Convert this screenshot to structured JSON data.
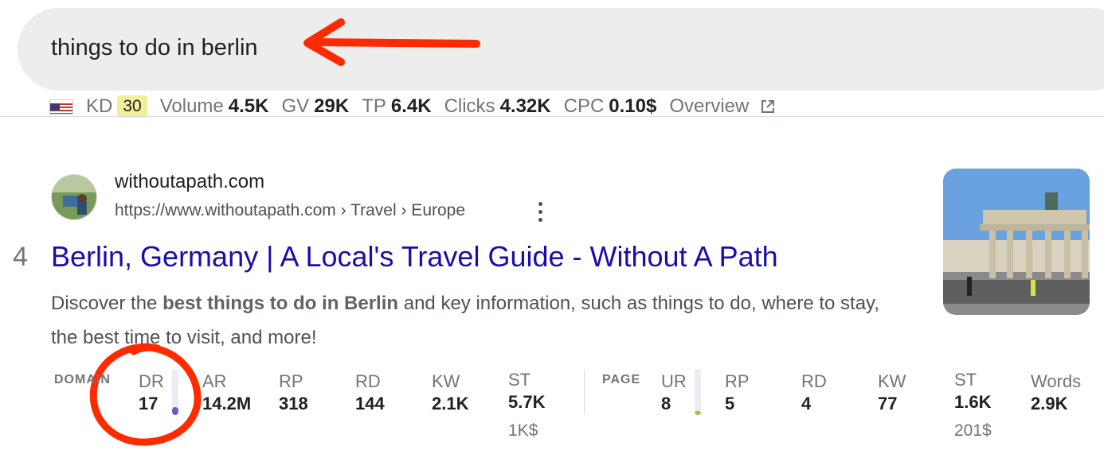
{
  "search": {
    "query": "things to do in berlin"
  },
  "keyword_metrics": {
    "country_flag": "us-flag",
    "kd_label": "KD",
    "kd_value": "30",
    "volume_label": "Volume",
    "volume_value": "4.5K",
    "gv_label": "GV",
    "gv_value": "29K",
    "tp_label": "TP",
    "tp_value": "6.4K",
    "clicks_label": "Clicks",
    "clicks_value": "4.32K",
    "cpc_label": "CPC",
    "cpc_value": "0.10$",
    "overview_label": "Overview"
  },
  "result": {
    "rank": "4",
    "site_name": "withoutapath.com",
    "url": "https://www.withoutapath.com › Travel › Europe",
    "title": "Berlin, Germany | A Local's Travel Guide - Without A Path",
    "snippet_pre": "Discover the ",
    "snippet_bold": "best things to do in Berlin",
    "snippet_post": " and key information, such as things to do, where to stay, the best time to visit, and more!"
  },
  "domain_metrics": {
    "section_label": "DOMAIN",
    "dr_label": "DR",
    "dr_value": "17",
    "dr_level": 0.17,
    "ar_label": "AR",
    "ar_value": "14.2M",
    "rp_label": "RP",
    "rp_value": "318",
    "rd_label": "RD",
    "rd_value": "144",
    "kw_label": "KW",
    "kw_value": "2.1K",
    "st_label": "ST",
    "st_value": "5.7K",
    "st_sub": "1K$"
  },
  "page_metrics": {
    "section_label": "PAGE",
    "ur_label": "UR",
    "ur_value": "8",
    "ur_level": 0.08,
    "rp_label": "RP",
    "rp_value": "5",
    "rd_label": "RD",
    "rd_value": "4",
    "kw_label": "KW",
    "kw_value": "77",
    "st_label": "ST",
    "st_value": "1.6K",
    "st_sub": "201$",
    "words_label": "Words",
    "words_value": "2.9K"
  },
  "colors": {
    "link": "#1a0dab",
    "annotation_red": "#ff2a00",
    "kd_badge": "#f1ef9a",
    "dr_bar": "#6a5acd",
    "ur_bar": "#9acd32"
  }
}
